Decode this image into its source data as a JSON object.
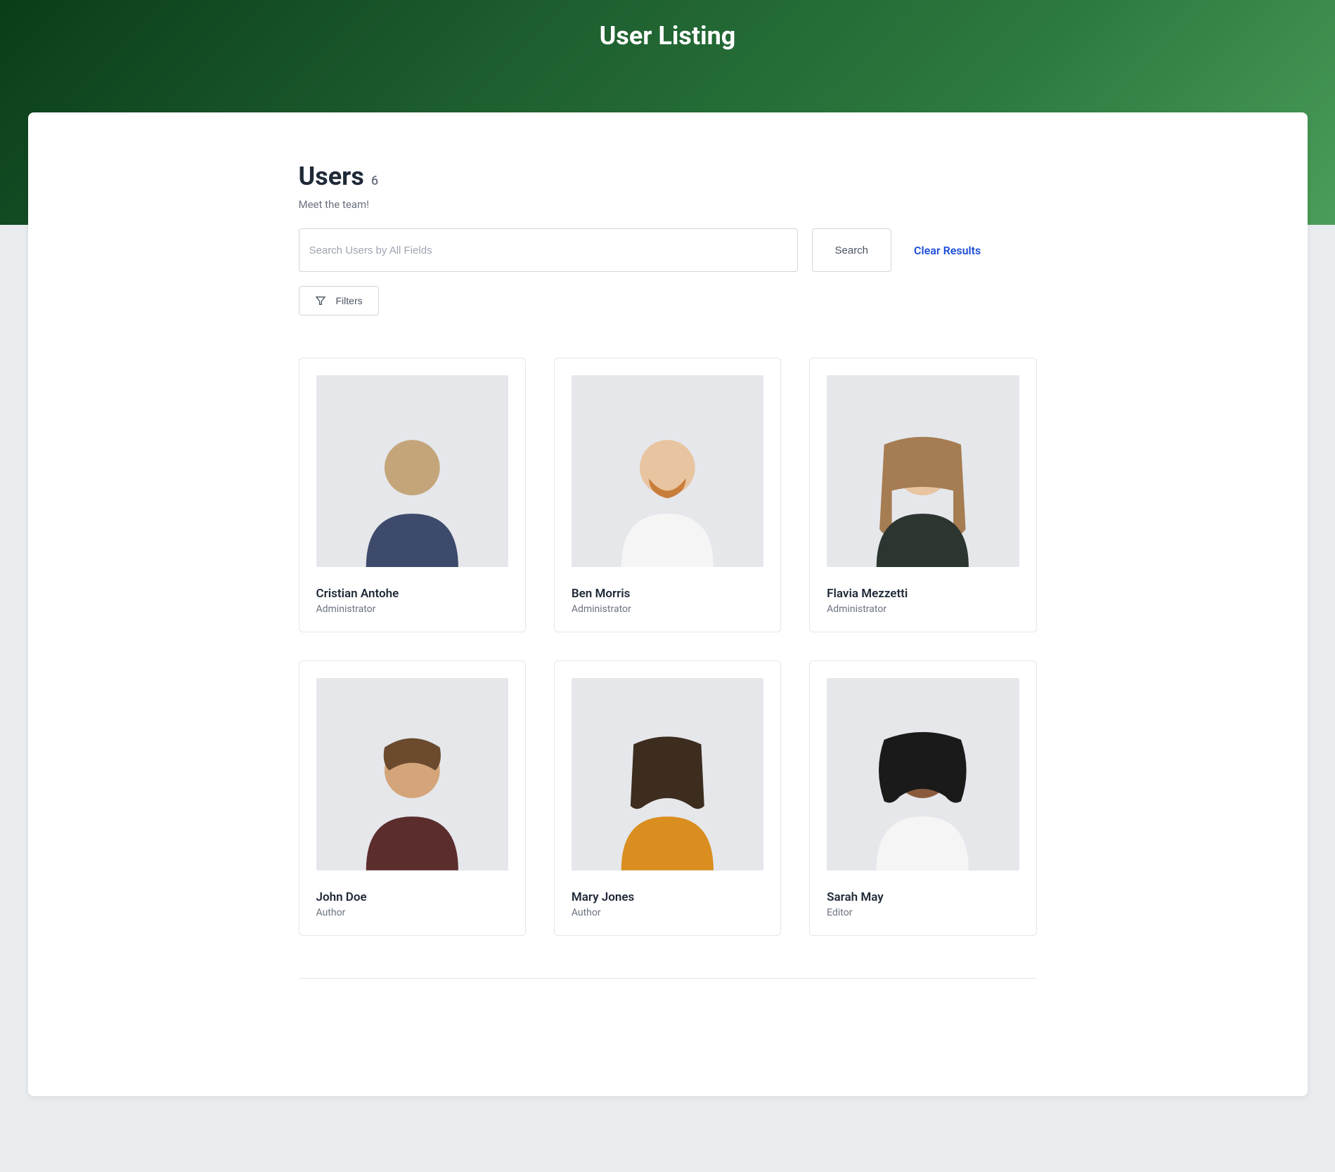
{
  "hero": {
    "title": "User Listing"
  },
  "section": {
    "heading": "Users",
    "count": "6",
    "subtitle": "Meet the team!"
  },
  "search": {
    "placeholder": "Search Users by All Fields",
    "button_label": "Search",
    "clear_label": "Clear Results"
  },
  "filters": {
    "label": "Filters"
  },
  "users": [
    {
      "name": "Cristian Antohe",
      "role": "Administrator"
    },
    {
      "name": "Ben Morris",
      "role": "Administrator"
    },
    {
      "name": "Flavia Mezzetti",
      "role": "Administrator"
    },
    {
      "name": "John Doe",
      "role": "Author"
    },
    {
      "name": "Mary Jones",
      "role": "Author"
    },
    {
      "name": "Sarah May",
      "role": "Editor"
    }
  ]
}
